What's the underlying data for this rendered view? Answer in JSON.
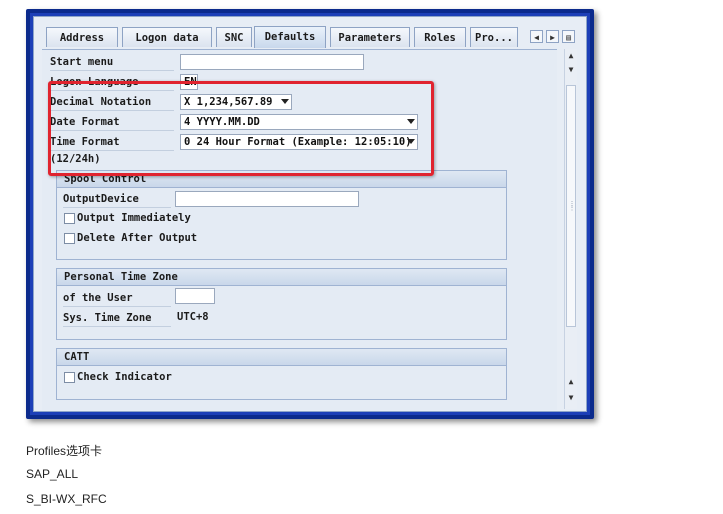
{
  "tabs": [
    {
      "label": "Address"
    },
    {
      "label": "Logon data"
    },
    {
      "label": "SNC"
    },
    {
      "label": "Defaults"
    },
    {
      "label": "Parameters"
    },
    {
      "label": "Roles"
    },
    {
      "label": "Pro..."
    }
  ],
  "active_tab": "Defaults",
  "defaults": {
    "start_menu_label": "Start menu",
    "start_menu_value": "",
    "logon_language_label": "Logon Language",
    "logon_language_value": "EN",
    "decimal_notation_label": "Decimal Notation",
    "decimal_notation_value": "X 1,234,567.89",
    "date_format_label": "Date Format",
    "date_format_value": "4 YYYY.MM.DD",
    "time_format_label": "Time Format (12/24h)",
    "time_format_value": "0 24 Hour Format (Example: 12:05:10)"
  },
  "spool": {
    "title": "Spool Control",
    "output_device_label": "OutputDevice",
    "output_device_value": "",
    "output_immediately_label": "Output Immediately",
    "delete_after_output_label": "Delete After Output"
  },
  "timezone": {
    "title": "Personal Time Zone",
    "of_the_user_label": "of the User",
    "of_the_user_value": "",
    "sys_time_zone_label": "Sys. Time Zone",
    "sys_time_zone_value": "UTC+8"
  },
  "catt": {
    "title": "CATT",
    "check_indicator_label": "Check Indicator"
  },
  "below_text": [
    "Profiles选项卡",
    "SAP_ALL",
    "S_BI-WX_RFC"
  ],
  "colors": {
    "frame": "#0b2a8c",
    "highlight": "#e0242f"
  }
}
